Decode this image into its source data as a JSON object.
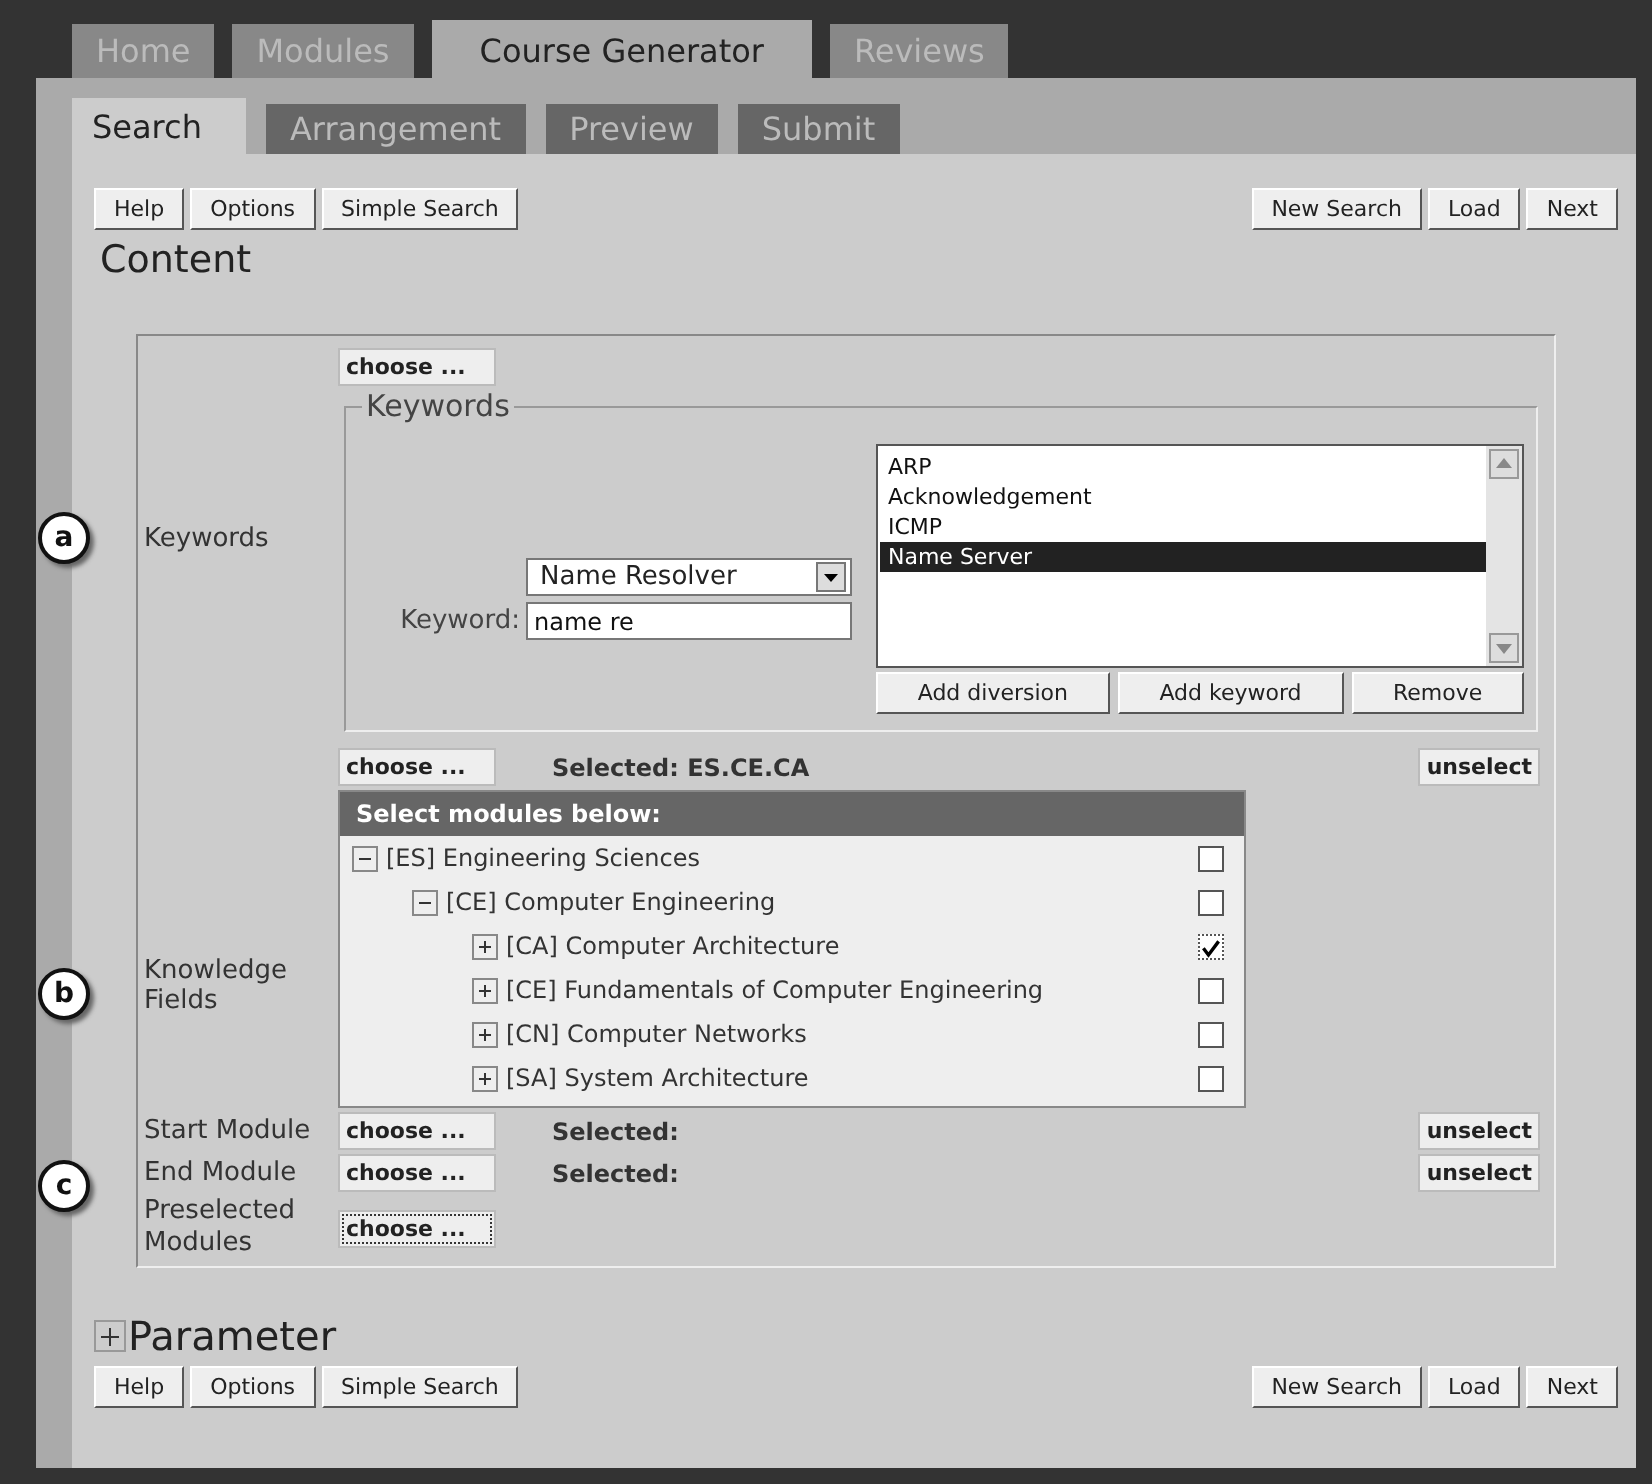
{
  "top_tabs": [
    {
      "label": "Home",
      "selected": false
    },
    {
      "label": "Modules",
      "selected": false
    },
    {
      "label": "Course Generator",
      "selected": true
    },
    {
      "label": "Reviews",
      "selected": false
    }
  ],
  "sub_tabs": [
    {
      "label": "Search",
      "selected": true
    },
    {
      "label": "Arrangement",
      "selected": false
    },
    {
      "label": "Preview",
      "selected": false
    },
    {
      "label": "Submit",
      "selected": false
    }
  ],
  "toolbar_top": {
    "left": [
      "Help",
      "Options",
      "Simple Search"
    ],
    "right": [
      "New Search",
      "Load",
      "Next"
    ]
  },
  "heading": "Content",
  "keywords": {
    "marker": "a",
    "label": "Keywords",
    "choose": "choose ...",
    "legend": "Keywords",
    "dropdown": "Name Resolver",
    "keyword_label": "Keyword:",
    "keyword_value": "name re",
    "list": [
      {
        "label": "ARP",
        "selected": false
      },
      {
        "label": "Acknowledgement",
        "selected": false
      },
      {
        "label": "ICMP",
        "selected": false
      },
      {
        "label": "Name Server",
        "selected": true
      }
    ],
    "buttons": [
      "Add diversion",
      "Add keyword",
      "Remove"
    ]
  },
  "knowledge": {
    "marker": "b",
    "label": "Knowledge Fields",
    "choose": "choose ...",
    "selected_text": "Selected: ES.CE.CA",
    "unselect": "unselect",
    "tree_header": "Select modules below:",
    "tree": [
      {
        "label": "[ES] Engineering Sciences",
        "expanded": true,
        "checked": false,
        "children": [
          {
            "label": "[CE] Computer Engineering",
            "expanded": true,
            "checked": false,
            "children": [
              {
                "label": "[CA] Computer Architecture",
                "expanded": false,
                "checked": true
              },
              {
                "label": "[CE] Fundamentals of Computer Engineering",
                "expanded": false,
                "checked": false
              },
              {
                "label": "[CN] Computer Networks",
                "expanded": false,
                "checked": false
              },
              {
                "label": "[SA] System Architecture",
                "expanded": false,
                "checked": false
              }
            ]
          }
        ]
      }
    ]
  },
  "module_marker": "c",
  "module_rows": [
    {
      "label": "Start Module",
      "choose": "choose ...",
      "selected_text": "Selected:",
      "unselect": "unselect"
    },
    {
      "label": "End Module",
      "choose": "choose ...",
      "selected_text": "Selected:",
      "unselect": "unselect"
    },
    {
      "label": "Preselected Modules",
      "choose": "choose ..."
    }
  ],
  "parameter": {
    "label": "Parameter",
    "expanded": false
  },
  "toolbar_bottom": {
    "left": [
      "Help",
      "Options",
      "Simple Search"
    ],
    "right": [
      "New Search",
      "Load",
      "Next"
    ]
  }
}
